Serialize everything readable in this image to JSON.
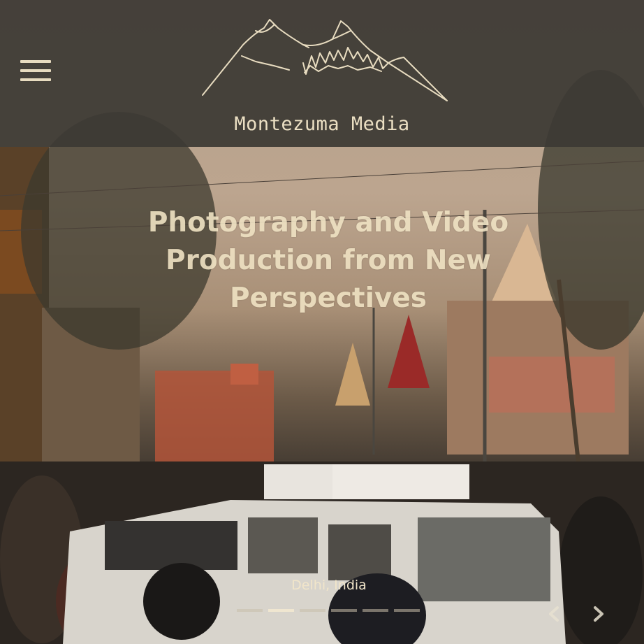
{
  "header": {
    "brand": "Montezuma Media",
    "menu_icon": "hamburger-menu-icon",
    "logo_icon": "mountains-logo-icon"
  },
  "hero": {
    "headline": "Photography and Video Production from New Perspectives",
    "caption": "Delhi, India",
    "slides": [
      {
        "active": false
      },
      {
        "active": true
      },
      {
        "active": false
      },
      {
        "active": false
      },
      {
        "active": false
      },
      {
        "active": false
      }
    ],
    "prev_icon": "chevron-left-icon",
    "next_icon": "chevron-right-icon"
  },
  "colors": {
    "header_bg": "#3c3934",
    "text_cream": "#ebdfc3"
  }
}
